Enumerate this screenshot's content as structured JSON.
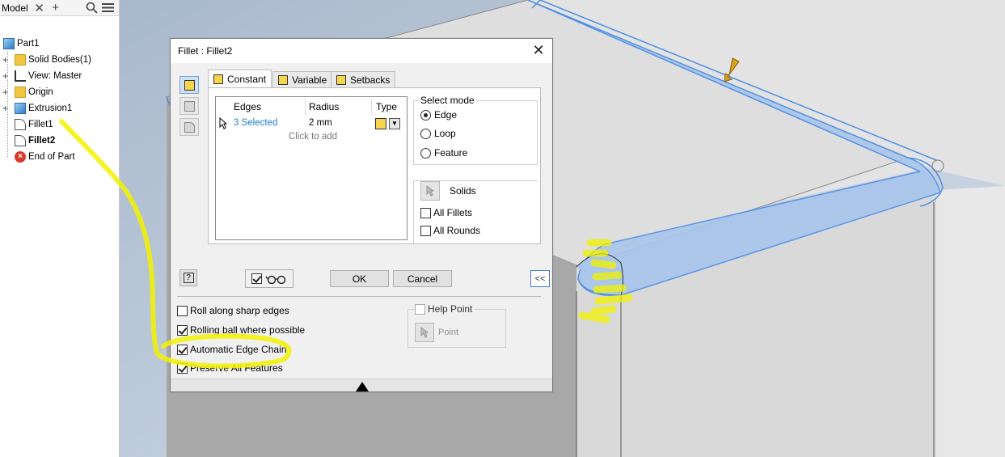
{
  "browser": {
    "tab_label": "Model",
    "close_glyph": "✕",
    "add_glyph": "+",
    "search_icon": "search-icon",
    "menu_icon": "menu-icon",
    "items": [
      {
        "label": "Part1",
        "icon": "part-icon",
        "expandable": false
      },
      {
        "label": "Solid Bodies(1)",
        "icon": "folder-icon",
        "expandable": true
      },
      {
        "label": "View: Master",
        "icon": "view-icon",
        "expandable": true
      },
      {
        "label": "Origin",
        "icon": "folder-icon",
        "expandable": true
      },
      {
        "label": "Extrusion1",
        "icon": "extrusion-icon",
        "expandable": true
      },
      {
        "label": "Fillet1",
        "icon": "fillet-icon",
        "expandable": false
      },
      {
        "label": "Fillet2",
        "icon": "fillet-icon",
        "expandable": false,
        "bold": true
      },
      {
        "label": "End of Part",
        "icon": "end-of-part-icon",
        "expandable": false
      }
    ]
  },
  "dialog": {
    "title": "Fillet : Fillet2",
    "close_glyph": "✕",
    "tabs": [
      {
        "label": "Constant",
        "active": true
      },
      {
        "label": "Variable",
        "active": false
      },
      {
        "label": "Setbacks",
        "active": false
      }
    ],
    "grid": {
      "columns": [
        "Edges",
        "Radius",
        "Type"
      ],
      "row": {
        "edges": "3 Selected",
        "radius": "2 mm"
      },
      "add_hint": "Click to add"
    },
    "select_mode": {
      "title": "Select mode",
      "options": [
        {
          "label": "Edge",
          "selected": true
        },
        {
          "label": "Loop",
          "selected": false
        },
        {
          "label": "Feature",
          "selected": false
        }
      ]
    },
    "solids": {
      "label": "Solids",
      "all_fillets": "All Fillets",
      "all_rounds": "All Rounds"
    },
    "buttons": {
      "ok": "OK",
      "cancel": "Cancel",
      "expand": "<<",
      "help": "?"
    },
    "options": [
      {
        "label": "Roll along sharp edges",
        "checked": false
      },
      {
        "label": "Rolling ball where possible",
        "checked": true
      },
      {
        "label": "Automatic Edge Chain",
        "checked": true
      },
      {
        "label": "Preserve All Features",
        "checked": true
      }
    ],
    "help_point": {
      "label": "Help Point",
      "point_label": "Point"
    }
  },
  "colors": {
    "accent_blue": "#1b7fd1",
    "highlight_yellow": "#f2f200",
    "selected_edge_blue": "#4d8fe8"
  }
}
